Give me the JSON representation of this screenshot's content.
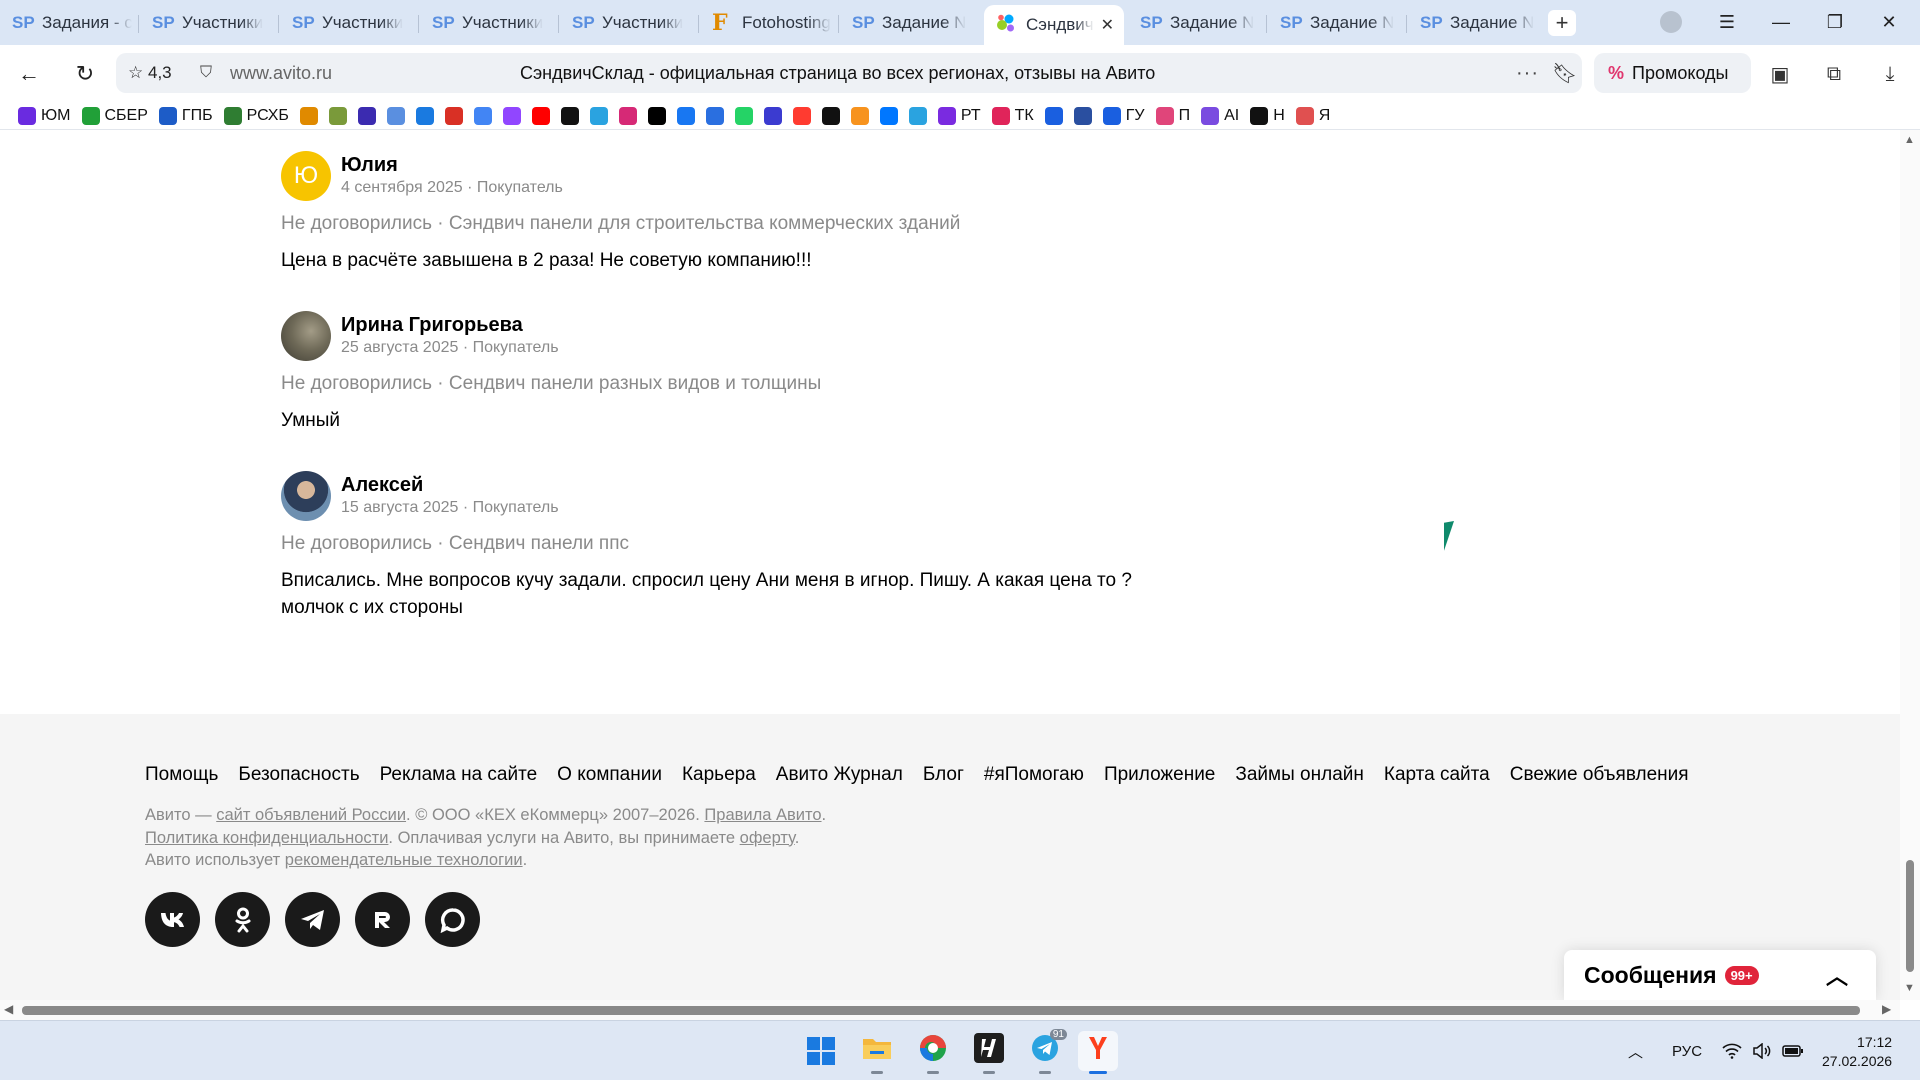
{
  "browser": {
    "tabs": [
      {
        "icon": "SP",
        "title": "Задания - с"
      },
      {
        "icon": "SP",
        "title": "Участники"
      },
      {
        "icon": "SP",
        "title": "Участники"
      },
      {
        "icon": "SP",
        "title": "Участники"
      },
      {
        "icon": "SP",
        "title": "Участники"
      },
      {
        "icon": "F",
        "title": "Fotohosting"
      },
      {
        "icon": "SP",
        "title": "Задание N"
      },
      {
        "icon": "avito",
        "title": "Сэндвич"
      },
      {
        "icon": "SP",
        "title": "Задание N"
      },
      {
        "icon": "SP",
        "title": "Задание N"
      },
      {
        "icon": "SP",
        "title": "Задание N"
      }
    ],
    "address": {
      "rating": "4,3",
      "url": "www.avito.ru",
      "page_title": "СэндвичСклад - официальная страница во всех регионах, отзывы на Авито"
    },
    "promo_label": "Промокоды",
    "bookmarks": [
      {
        "label": "ЮМ",
        "color": "#6a2be0"
      },
      {
        "label": "СБЕР",
        "color": "#21a038"
      },
      {
        "label": "ГПБ",
        "color": "#1d5cc7"
      },
      {
        "label": "РСХБ",
        "color": "#2f7d32"
      },
      {
        "label": "",
        "color": "#e08a00"
      },
      {
        "label": "",
        "color": "#7a9a3a"
      },
      {
        "label": "",
        "color": "#3b2bb0"
      },
      {
        "label": "",
        "color": "#5a8fe0"
      },
      {
        "label": "",
        "color": "#1a7ae0"
      },
      {
        "label": "",
        "color": "#d93025"
      },
      {
        "label": "",
        "color": "#4285f4"
      },
      {
        "label": "",
        "color": "#9146ff"
      },
      {
        "label": "",
        "color": "#ff0000"
      },
      {
        "label": "",
        "color": "#111111"
      },
      {
        "label": "",
        "color": "#2aa3e0"
      },
      {
        "label": "",
        "color": "#d62976"
      },
      {
        "label": "",
        "color": "#000000"
      },
      {
        "label": "",
        "color": "#1877f2"
      },
      {
        "label": "",
        "color": "#2a6fe0"
      },
      {
        "label": "",
        "color": "#25d366"
      },
      {
        "label": "",
        "color": "#3b3bd0"
      },
      {
        "label": "",
        "color": "#ff3b30"
      },
      {
        "label": "",
        "color": "#111111"
      },
      {
        "label": "",
        "color": "#f7931e"
      },
      {
        "label": "",
        "color": "#0077ff"
      },
      {
        "label": "",
        "color": "#2aa3e0"
      },
      {
        "label": "РТ",
        "color": "#7a2be0"
      },
      {
        "label": "ТК",
        "color": "#e0245a"
      },
      {
        "label": "",
        "color": "#1a5fe0"
      },
      {
        "label": "",
        "color": "#2a4fa0"
      },
      {
        "label": "ГУ",
        "color": "#1a5fe0"
      },
      {
        "label": "П",
        "color": "#e0457a"
      },
      {
        "label": "AI",
        "color": "#7a4be0"
      },
      {
        "label": "Н",
        "color": "#111111"
      },
      {
        "label": "Я",
        "color": "#e05050"
      }
    ]
  },
  "reviews": [
    {
      "avatar_letter": "Ю",
      "name": "Юлия",
      "meta": "4 сентября 2025 · Покупатель",
      "deal": "Не договорились · Сэндвич панели для строительства коммерческих зданий",
      "text": "Цена в расчёте завышена в 2 раза! Не советую компанию!!!"
    },
    {
      "avatar_letter": "",
      "name": "Ирина Григорьева",
      "meta": "25 августа 2025 · Покупатель",
      "deal": "Не договорились · Сендвич панели разных видов и толщины",
      "text": "Умный"
    },
    {
      "avatar_letter": "",
      "name": "Алексей",
      "meta": "15 августа 2025 · Покупатель",
      "deal": "Не договорились · Сендвич панели ппс",
      "text_line1": "Вписались. Мне вопросов кучу задали. спросил цену Ани меня в игнор. Пишу. А какая цена то ?",
      "text_line2": "молчок с их стороны"
    }
  ],
  "footer": {
    "links": [
      "Помощь",
      "Безопасность",
      "Реклама на сайте",
      "О компании",
      "Карьера",
      "Авито Журнал",
      "Блог",
      "#яПомогаю",
      "Приложение",
      "Займы онлайн",
      "Карта сайта",
      "Свежие объявления"
    ],
    "legal": {
      "l1_a": "Авито — ",
      "l1_link": "сайт объявлений России",
      "l1_b": ". © ООО «КЕХ еКоммерц» 2007–2026. ",
      "l1_link2": "Правила Авито",
      "l1_c": ".",
      "l2_link": "Политика конфиденциальности",
      "l2_a": ". Оплачивая услуги на Авито, вы принимаете ",
      "l2_link2": "оферту",
      "l2_b": ".",
      "l3_a": "Авито использует ",
      "l3_link": "рекомендательные технологии",
      "l3_b": "."
    },
    "socials": [
      "vk-icon",
      "ok-icon",
      "telegram-icon",
      "rutube-icon",
      "max-icon"
    ]
  },
  "messages": {
    "title": "Сообщения",
    "badge": "99+"
  },
  "taskbar": {
    "lang": "РУС",
    "time": "17:12",
    "date": "27.02.2026",
    "telegram_badge": "91"
  }
}
